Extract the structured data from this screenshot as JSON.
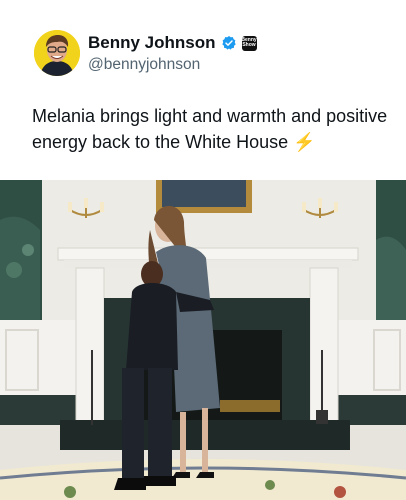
{
  "post": {
    "author_name": "Benny Johnson",
    "author_handle": "@bennyjohnson",
    "text": "Melania brings light and warmth and positive energy back to the White House",
    "emoji": "⚡",
    "affiliate_badge_line1": "Benny",
    "affiliate_badge_line2": "Show"
  },
  "icons": {
    "verified": "verified-badge-icon",
    "affiliate": "affiliate-badge-icon",
    "emoji": "lightning-emoji"
  },
  "colors": {
    "verified_blue": "#1d9bf0",
    "avatar_bg": "#f2d31b",
    "text_primary": "#0f1419",
    "text_secondary": "#536471"
  }
}
